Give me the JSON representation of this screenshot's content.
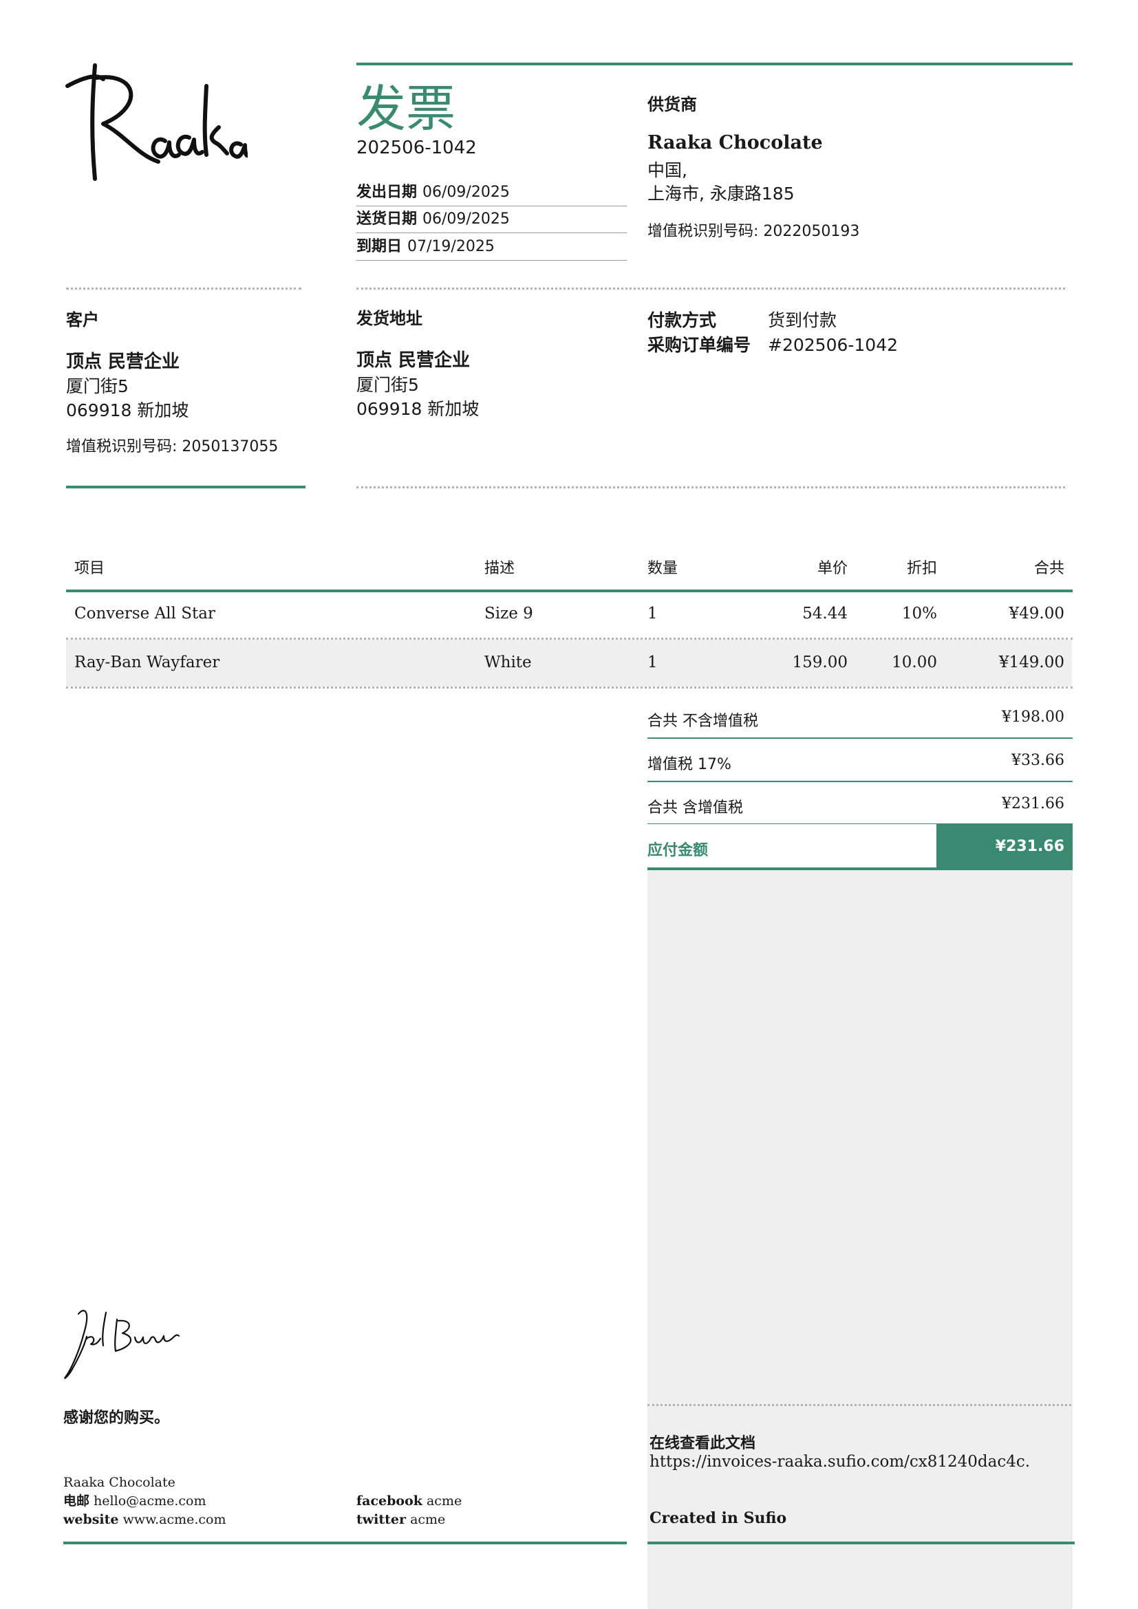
{
  "brand": {
    "logo_text": "Raaka",
    "signature_text": "Jel Burt"
  },
  "invoice": {
    "title": "发票",
    "number": "202506-1042",
    "dates": [
      {
        "label": "发出日期",
        "value": "06/09/2025"
      },
      {
        "label": "送货日期",
        "value": "06/09/2025"
      },
      {
        "label": "到期日",
        "value": "07/19/2025"
      }
    ]
  },
  "supplier": {
    "heading": "供货商",
    "name": "Raaka Chocolate",
    "address1": "中国,",
    "address2": "上海市, 永康路185",
    "vat": "增值税识别号码: 2022050193"
  },
  "customer": {
    "heading": "客户",
    "name": "顶点 民营企业",
    "address1": "厦门街5",
    "address2": "069918 新加坡",
    "vat": "增值税识别号码: 2050137055"
  },
  "shipping": {
    "heading": "发货地址",
    "name": "顶点 民营企业",
    "address1": "厦门街5",
    "address2": "069918 新加坡"
  },
  "payment": {
    "method_label": "付款方式",
    "method_value": "货到付款",
    "po_label": "采购订单编号",
    "po_value": "#202506-1042"
  },
  "table": {
    "headers": {
      "item": "项目",
      "desc": "描述",
      "qty": "数量",
      "price": "单价",
      "discount": "折扣",
      "total": "合共"
    },
    "rows": [
      {
        "item": "Converse All Star",
        "desc": "Size 9",
        "qty": "1",
        "price": "54.44",
        "discount": "10%",
        "total": "¥49.00"
      },
      {
        "item": "Ray-Ban Wayfarer",
        "desc": "White",
        "qty": "1",
        "price": "159.00",
        "discount": "10.00",
        "total": "¥149.00"
      }
    ]
  },
  "totals": {
    "subtotal_label": "合共 不含增值税",
    "subtotal_value": "¥198.00",
    "vat_label": "增值税 17%",
    "vat_value": "¥33.66",
    "total_label": "合共 含增值税",
    "total_value": "¥231.66",
    "due_label": "应付金额",
    "due_value": "¥231.66"
  },
  "online": {
    "heading": "在线查看此文档",
    "url": "https://invoices-raaka.sufio.com/cx81240dac4c.",
    "created": "Created in Sufio"
  },
  "footer": {
    "thanks": "感谢您的购买。",
    "company": "Raaka Chocolate",
    "email_label": "电邮",
    "email_value": "hello@acme.com",
    "website_label": "website",
    "website_value": "www.acme.com",
    "facebook_label": "facebook",
    "facebook_value": "acme",
    "twitter_label": "twitter",
    "twitter_value": "acme"
  },
  "colors": {
    "accent": "#3a8a72",
    "panel": "#efefef",
    "text": "#1a1a1a"
  }
}
